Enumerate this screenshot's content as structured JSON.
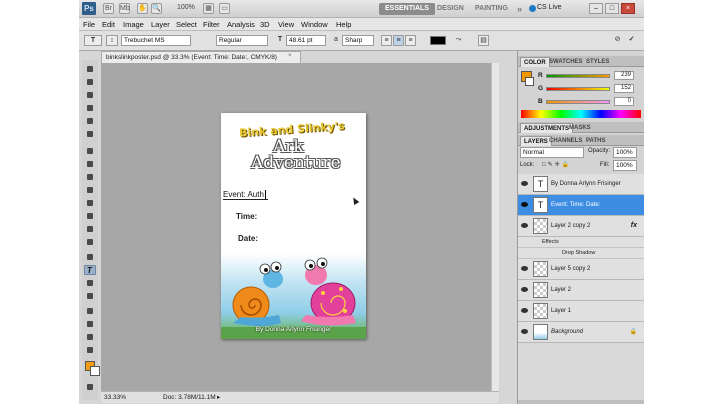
{
  "app": {
    "logo": "Ps",
    "zoom": "100%",
    "workspaces": [
      "ESSENTIALS",
      "DESIGN",
      "PAINTING",
      "»"
    ],
    "cs_live": "CS Live",
    "window_buttons": [
      "–",
      "□",
      "×"
    ]
  },
  "menu": [
    "File",
    "Edit",
    "Image",
    "Layer",
    "Select",
    "Filter",
    "Analysis",
    "3D",
    "View",
    "Window",
    "Help"
  ],
  "options": {
    "tool_glyph": "T",
    "font_family": "Trebuchet MS",
    "font_style": "Regular",
    "font_size": "48.61 pt",
    "antialias_glyph": "a",
    "antialias": "Sharp",
    "text_color": "#000000"
  },
  "document": {
    "tab_title": "binkslinkposter.psd @ 33.3% (Event:  Time:  Date:, CMYK/8)",
    "tab_close": "×",
    "title_line1": "Bink and Slinky's",
    "title_line2": "Ark",
    "title_line3": "Adventure",
    "event_text": "Event: Auth",
    "time_label": "Time:",
    "date_label": "Date:",
    "credit": "By Donna Arlynn Frisinger"
  },
  "status": {
    "zoom": "33.33%",
    "doc_info": "Doc: 3.78M/11.1M"
  },
  "color_panel": {
    "tabs": [
      "COLOR",
      "SWATCHES",
      "STYLES"
    ],
    "r_label": "R",
    "g_label": "G",
    "b_label": "B",
    "r": "239",
    "g": "152",
    "b": "0",
    "fg_color": "#ef9800"
  },
  "adjustments_panel": {
    "tabs": [
      "ADJUSTMENTS",
      "MASKS"
    ]
  },
  "layers_panel": {
    "tabs": [
      "LAYERS",
      "CHANNELS",
      "PATHS"
    ],
    "blend_mode": "Normal",
    "opacity_label": "Opacity:",
    "opacity": "100%",
    "lock_label": "Lock:",
    "fill_label": "Fill:",
    "fill": "100%",
    "layers": [
      {
        "name": "By Donna Arlynn Frisinger",
        "thumb": "T"
      },
      {
        "name": "Event:  Time:  Date:",
        "thumb": "T"
      },
      {
        "name": "Layer 2 copy 2",
        "thumb": "",
        "fx": "fx"
      },
      {
        "name": "Effects"
      },
      {
        "name": "Drop Shadow"
      },
      {
        "name": "Layer 5 copy 2",
        "thumb": ""
      },
      {
        "name": "Layer 2",
        "thumb": ""
      },
      {
        "name": "Layer 1",
        "thumb": ""
      },
      {
        "name": "Background",
        "thumb": ""
      }
    ]
  }
}
